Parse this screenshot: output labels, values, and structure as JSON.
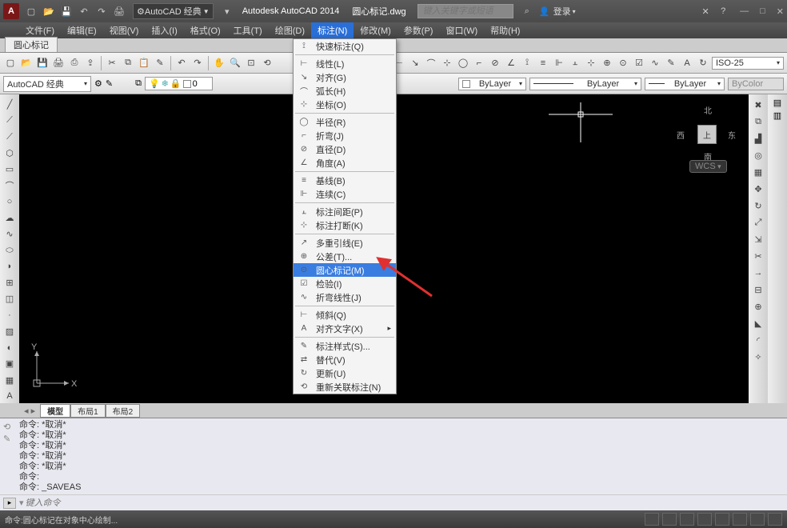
{
  "app": {
    "logo_letter": "A",
    "workspace": "AutoCAD 经典",
    "product": "Autodesk AutoCAD 2014",
    "filename": "圆心标记.dwg",
    "search_placeholder": "键入关键字或短语",
    "login": "登录"
  },
  "menubar": [
    "文件(F)",
    "编辑(E)",
    "视图(V)",
    "插入(I)",
    "格式(O)",
    "工具(T)",
    "绘图(D)",
    "标注(N)",
    "修改(M)",
    "参数(P)",
    "窗口(W)",
    "帮助(H)"
  ],
  "active_menu_index": 7,
  "doc_tab": "圆心标记",
  "toolbar2_dim_style": "ISO-25",
  "props": {
    "workspace_sel": "AutoCAD 经典",
    "layer": "0",
    "color": "ByLayer",
    "linetype": "ByLayer",
    "lineweight": "ByLayer",
    "plotstyle": "ByColor"
  },
  "navcube": {
    "top": "北",
    "left": "西",
    "right": "东",
    "bottom": "南",
    "center": "上",
    "wcs": "WCS"
  },
  "ucs": {
    "x": "X",
    "y": "Y"
  },
  "layout_tabs": [
    "模型",
    "布局1",
    "布局2"
  ],
  "cmd_history": [
    "命令: *取消*",
    "命令: *取消*",
    "命令: *取消*",
    "命令: *取消*",
    "命令: *取消*",
    "命令:",
    "命令: _SAVEAS"
  ],
  "cmd_placeholder": "键入命令",
  "status_text": "命令:圆心标记在对象中心绘制...",
  "dropdown": {
    "groups": [
      [
        {
          "icon": "⟟",
          "label": "快速标注(Q)"
        }
      ],
      [
        {
          "icon": "⊢",
          "label": "线性(L)"
        },
        {
          "icon": "↘",
          "label": "对齐(G)"
        },
        {
          "icon": "⌒",
          "label": "弧长(H)"
        },
        {
          "icon": "⊹",
          "label": "坐标(O)"
        }
      ],
      [
        {
          "icon": "◯",
          "label": "半径(R)"
        },
        {
          "icon": "⌐",
          "label": "折弯(J)"
        },
        {
          "icon": "⊘",
          "label": "直径(D)"
        },
        {
          "icon": "∠",
          "label": "角度(A)"
        }
      ],
      [
        {
          "icon": "≡",
          "label": "基线(B)"
        },
        {
          "icon": "⊩",
          "label": "连续(C)"
        }
      ],
      [
        {
          "icon": "⫠",
          "label": "标注间距(P)"
        },
        {
          "icon": "⊹",
          "label": "标注打断(K)"
        }
      ],
      [
        {
          "icon": "↗",
          "label": "多重引线(E)"
        },
        {
          "icon": "⊕",
          "label": "公差(T)...",
          "submenu": false
        },
        {
          "icon": "⊙",
          "label": "圆心标记(M)",
          "highlighted": true
        },
        {
          "icon": "☑",
          "label": "检验(I)"
        },
        {
          "icon": "∿",
          "label": "折弯线性(J)"
        }
      ],
      [
        {
          "icon": "⊢",
          "label": "倾斜(Q)"
        },
        {
          "icon": "A",
          "label": "对齐文字(X)",
          "submenu": true
        }
      ],
      [
        {
          "icon": "✎",
          "label": "标注样式(S)..."
        },
        {
          "icon": "⇄",
          "label": "替代(V)"
        },
        {
          "icon": "↻",
          "label": "更新(U)"
        },
        {
          "icon": "⟲",
          "label": "重新关联标注(N)"
        }
      ]
    ]
  }
}
